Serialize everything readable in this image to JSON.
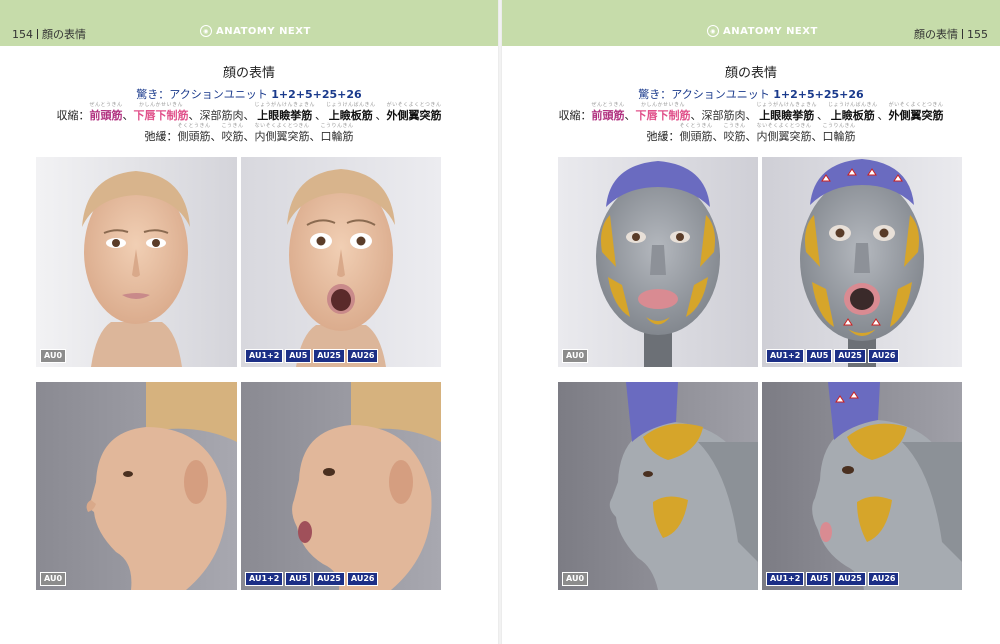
{
  "left_page": {
    "page_number": "154",
    "section": "顔の表情",
    "brand": "ANATOMY NEXT"
  },
  "right_page": {
    "page_number": "155",
    "section": "顔の表情",
    "brand": "ANATOMY NEXT"
  },
  "heading": {
    "title": "顔の表情",
    "surprise_label": "驚き：",
    "action_unit_label": "アクションユニット",
    "au_formula": "1+2+5+25+26",
    "contraction_label": "収縮：",
    "contraction_muscles": [
      {
        "name": "前頭筋",
        "ruby": "ぜんとうきん",
        "style": "purple"
      },
      {
        "name": "下唇下制筋",
        "ruby": "かしんかせいきん",
        "style": "pink"
      },
      {
        "name": "深部筋肉",
        "ruby": "",
        "style": "normal"
      },
      {
        "name": "上眼瞼挙筋",
        "ruby": "じょうがんけんきょきん",
        "style": "dark"
      },
      {
        "name": "上瞼板筋",
        "ruby": "じょうけんばんきん",
        "style": "dark"
      },
      {
        "name": "外側翼突筋",
        "ruby": "がいそくよくとつきん",
        "style": "dark"
      }
    ],
    "relaxation_label": "弛緩：",
    "relaxation_muscles": [
      {
        "name": "側頭筋",
        "ruby": "そくとうきん"
      },
      {
        "name": "咬筋",
        "ruby": "こうきん"
      },
      {
        "name": "内側翼突筋",
        "ruby": "ないそくよくとつきん"
      },
      {
        "name": "口輪筋",
        "ruby": "こうりんきん"
      }
    ],
    "separator": "、"
  },
  "badges": {
    "neutral": [
      "AU0"
    ],
    "surprise": [
      "AU1+2",
      "AU5",
      "AU25",
      "AU26"
    ]
  },
  "colors": {
    "header_band": "#c6dcaa",
    "badge_blue": "#1c2f86",
    "badge_gray": "#8c8c8c",
    "frontalis": "#6a6bc0",
    "fat": "#d6a52a",
    "lip": "#d98b92",
    "skin": "#e8c3a6",
    "muscle_gray": "#9ea3a9"
  },
  "images": [
    {
      "id": "left-front-neutral",
      "label": "front view neutral face"
    },
    {
      "id": "left-front-surprise",
      "label": "front view surprised face"
    },
    {
      "id": "left-side-neutral",
      "label": "profile neutral face"
    },
    {
      "id": "left-side-surprise",
      "label": "profile surprised face"
    },
    {
      "id": "right-front-neutral",
      "label": "front muscle anatomy neutral"
    },
    {
      "id": "right-front-surprise",
      "label": "front muscle anatomy surprised"
    },
    {
      "id": "right-side-neutral",
      "label": "profile muscle anatomy neutral"
    },
    {
      "id": "right-side-surprise",
      "label": "profile muscle anatomy surprised"
    }
  ]
}
